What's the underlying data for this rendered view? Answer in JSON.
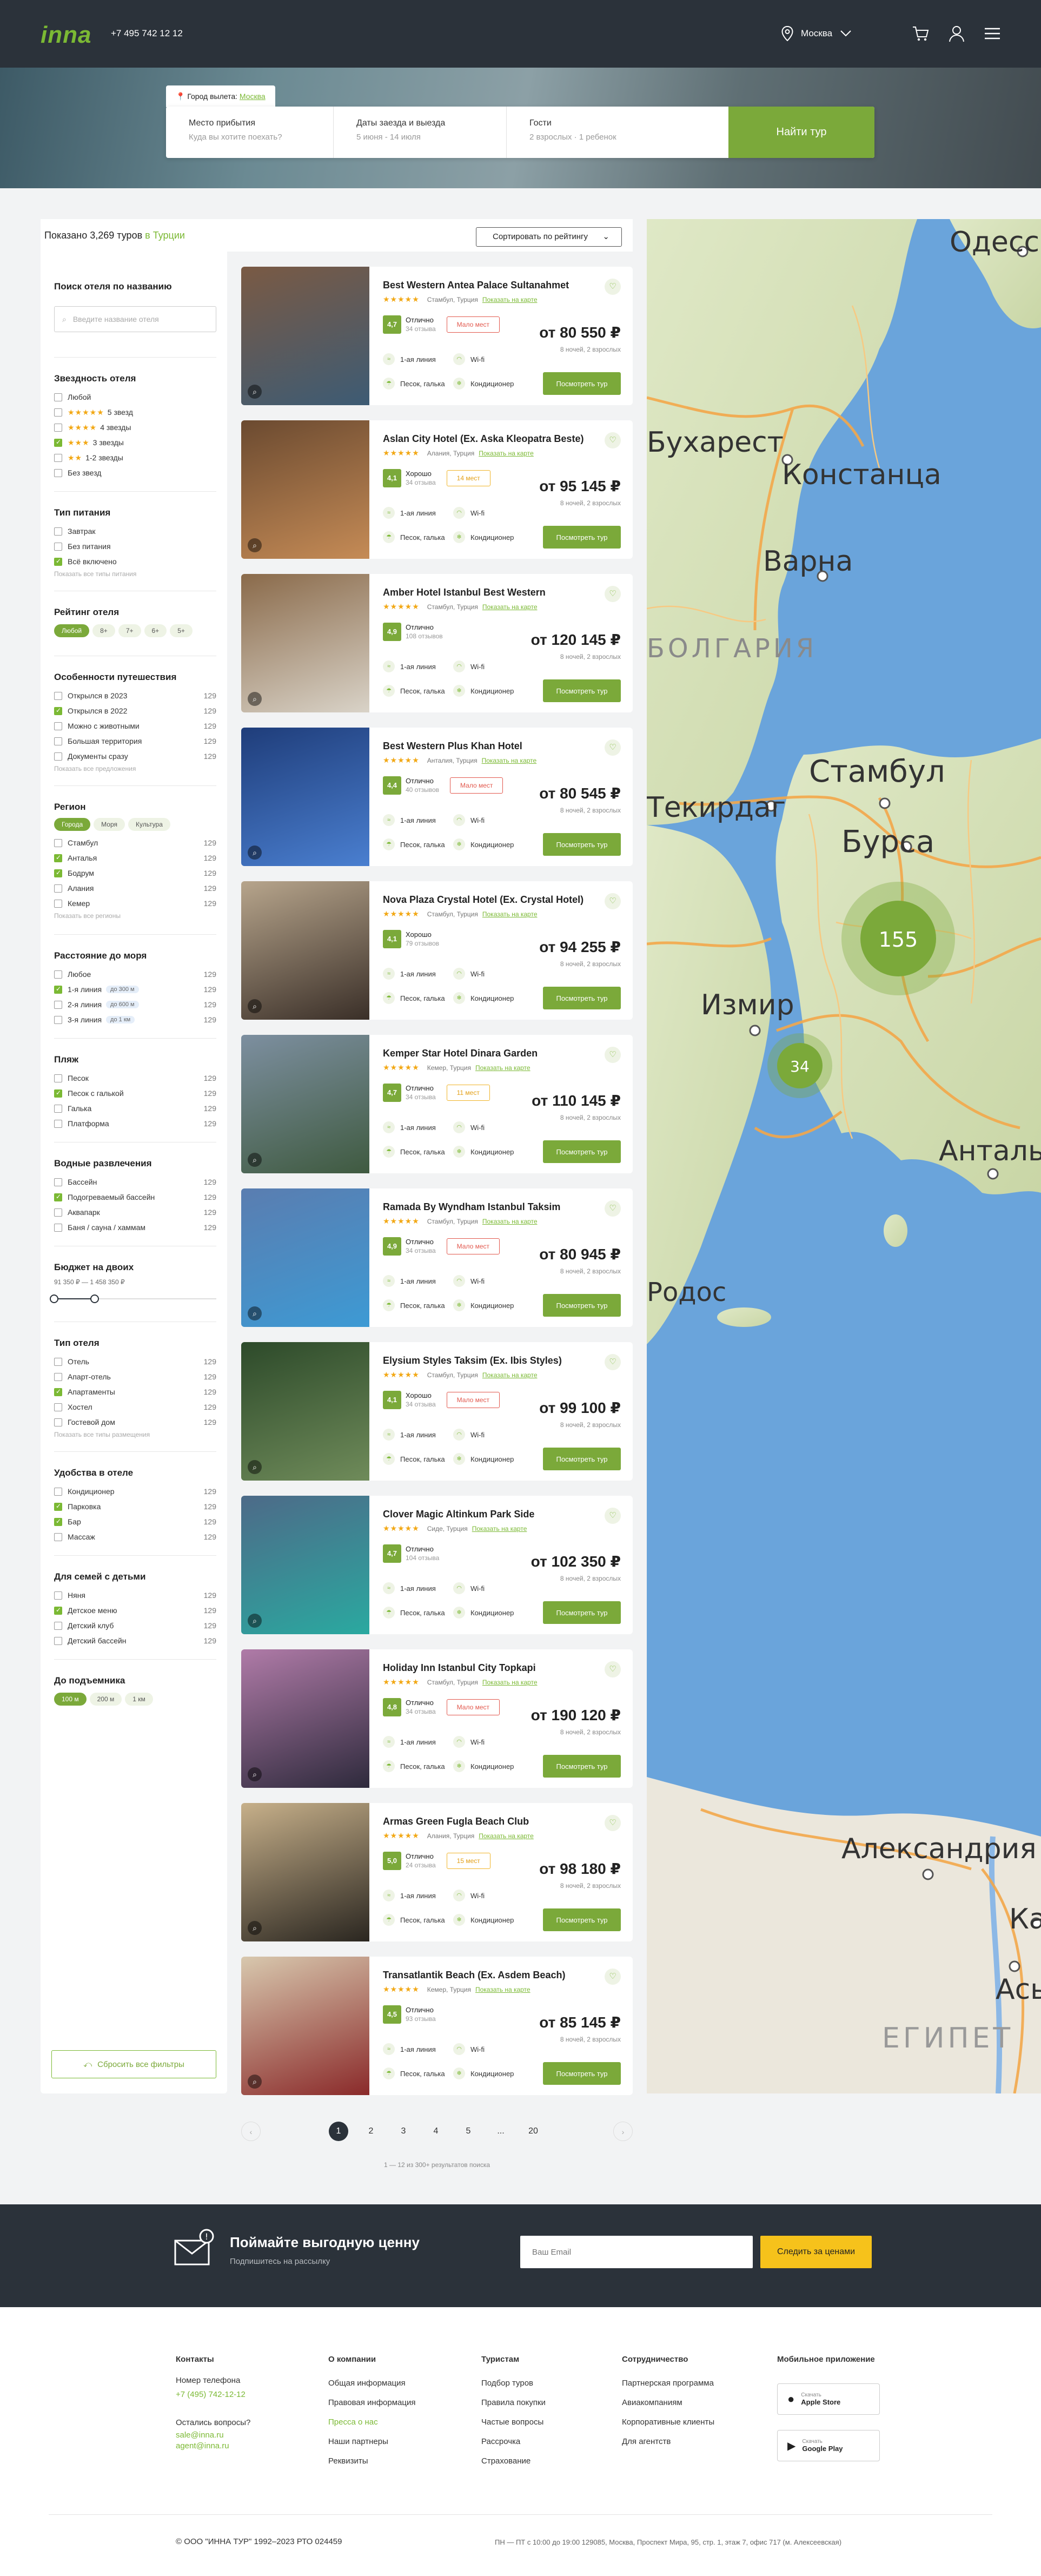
{
  "header": {
    "logo": "inna",
    "phone": "+7 495 742 12 12",
    "city": "Москва"
  },
  "hero": {
    "departure_label": "Город вылета:",
    "departure_city": "Москва",
    "fields": [
      {
        "label": "Место прибытия",
        "value": "Куда вы хотите поехать?"
      },
      {
        "label": "Даты заезда и выезда",
        "value": "5 июня - 14 июля"
      },
      {
        "label": "Гости",
        "value": "2 взрослых · 1 ребенок"
      }
    ],
    "button": "Найти тур"
  },
  "results": {
    "prefix": "Показано",
    "count": "3,269 туров",
    "suffix": "в Турции",
    "sort": "Сортировать по рейтингу"
  },
  "filters": {
    "name_search": {
      "title": "Поиск отеля по названию",
      "placeholder": "Введите название отеля"
    },
    "stars": {
      "title": "Звездность отеля",
      "items": [
        {
          "label": "Любой",
          "stars": "",
          "on": false
        },
        {
          "label": "5 звезд",
          "stars": "★★★★★",
          "on": false
        },
        {
          "label": "4 звезды",
          "stars": "★★★★",
          "on": false
        },
        {
          "label": "3 звезды",
          "stars": "★★★",
          "on": true
        },
        {
          "label": "1-2 звезды",
          "stars": "★★",
          "on": false
        },
        {
          "label": "Без звезд",
          "stars": "",
          "on": false
        }
      ]
    },
    "meal": {
      "title": "Тип питания",
      "items": [
        {
          "label": "Завтрак",
          "on": false
        },
        {
          "label": "Без питания",
          "on": false
        },
        {
          "label": "Всё включено",
          "on": true
        }
      ],
      "more": "Показать все типы питания"
    },
    "rating": {
      "title": "Рейтинг отеля",
      "pills": [
        "Любой",
        "8+",
        "7+",
        "6+",
        "5+"
      ]
    },
    "features": {
      "title": "Особенности путешествия",
      "items": [
        {
          "label": "Открылся в 2023",
          "count": "129",
          "on": false
        },
        {
          "label": "Открылся в 2022",
          "count": "129",
          "on": true
        },
        {
          "label": "Можно с животными",
          "count": "129",
          "on": false
        },
        {
          "label": "Большая территория",
          "count": "129",
          "on": false
        },
        {
          "label": "Документы сразу",
          "count": "129",
          "on": false
        }
      ],
      "more": "Показать все предложения"
    },
    "region": {
      "title": "Регион",
      "tabs": [
        "Города",
        "Моря",
        "Культура"
      ],
      "items": [
        {
          "label": "Стамбул",
          "count": "129",
          "on": false
        },
        {
          "label": "Анталья",
          "count": "129",
          "on": true
        },
        {
          "label": "Бодрум",
          "count": "129",
          "on": true
        },
        {
          "label": "Алания",
          "count": "129",
          "on": false
        },
        {
          "label": "Кемер",
          "count": "129",
          "on": false
        }
      ],
      "more": "Показать все регионы"
    },
    "sea": {
      "title": "Расстояние до моря",
      "items": [
        {
          "label": "Любое",
          "count": "129",
          "on": false,
          "chip": ""
        },
        {
          "label": "1-я линия",
          "count": "129",
          "on": true,
          "chip": "до 300 м"
        },
        {
          "label": "2-я линия",
          "count": "129",
          "on": false,
          "chip": "до 600 м"
        },
        {
          "label": "3-я линия",
          "count": "129",
          "on": false,
          "chip": "до 1 км"
        }
      ]
    },
    "beach": {
      "title": "Пляж",
      "items": [
        {
          "label": "Песок",
          "count": "129",
          "on": false
        },
        {
          "label": "Песок с галькой",
          "count": "129",
          "on": true
        },
        {
          "label": "Галька",
          "count": "129",
          "on": false
        },
        {
          "label": "Платформа",
          "count": "129",
          "on": false
        }
      ]
    },
    "water": {
      "title": "Водные развлечения",
      "items": [
        {
          "label": "Бассейн",
          "count": "129",
          "on": false
        },
        {
          "label": "Подогреваемый бассейн",
          "count": "129",
          "on": true
        },
        {
          "label": "Аквапарк",
          "count": "129",
          "on": false
        },
        {
          "label": "Баня / сауна / хаммам",
          "count": "129",
          "on": false
        }
      ]
    },
    "budget": {
      "title": "Бюджет на двоих",
      "range": "91 350 ₽ — 1 458 350 ₽",
      "low_fraction": 0.0,
      "high_fraction": 0.25
    },
    "hotel_type": {
      "title": "Тип отеля",
      "items": [
        {
          "label": "Отель",
          "count": "129",
          "on": false
        },
        {
          "label": "Апарт-отель",
          "count": "129",
          "on": false
        },
        {
          "label": "Апартаменты",
          "count": "129",
          "on": true
        },
        {
          "label": "Хостел",
          "count": "129",
          "on": false
        },
        {
          "label": "Гостевой дом",
          "count": "129",
          "on": false
        }
      ],
      "more": "Показать все типы размещения"
    },
    "amenities": {
      "title": "Удобства в отеле",
      "items": [
        {
          "label": "Кондиционер",
          "count": "129",
          "on": false
        },
        {
          "label": "Парковка",
          "count": "129",
          "on": true
        },
        {
          "label": "Бар",
          "count": "129",
          "on": true
        },
        {
          "label": "Массаж",
          "count": "129",
          "on": false
        }
      ]
    },
    "family": {
      "title": "Для семей с детьми",
      "items": [
        {
          "label": "Няня",
          "count": "129",
          "on": false
        },
        {
          "label": "Детское меню",
          "count": "129",
          "on": true
        },
        {
          "label": "Детский клуб",
          "count": "129",
          "on": false
        },
        {
          "label": "Детский бассейн",
          "count": "129",
          "on": false
        }
      ]
    },
    "lift": {
      "title": "До подъемника",
      "pills": [
        "100 м",
        "200 м",
        "1 км"
      ]
    },
    "reset": "Сбросить все фильтры"
  },
  "card_common": {
    "map_link": "Показать на карте",
    "price_note": "8 ночей, 2 взрослых",
    "button": "Посмотреть тур",
    "f1": "1-ая линия",
    "f2": "Wi-fi",
    "f3": "Песок, галька",
    "f4": "Кондиционер"
  },
  "hotels": [
    {
      "name": "Best Western Antea Palace Sultanahmet",
      "loc": "Стамбул, Турция",
      "score": "4,7",
      "rlabel": "Отлично",
      "reviews": "34 отзыва",
      "badge": "Мало мест",
      "badge_type": "r",
      "price": "от 80 550 ₽",
      "img": [
        "#7a5a44",
        "#3d5b74"
      ]
    },
    {
      "name": "Aslan City Hotel (Ex. Aska Kleopatra Beste)",
      "loc": "Алания, Турция",
      "score": "4,1",
      "rlabel": "Хорошо",
      "reviews": "34 отзыва",
      "badge": "14 мест",
      "badge_type": "y",
      "price": "от 95 145 ₽",
      "img": [
        "#6b4a30",
        "#c58b56"
      ]
    },
    {
      "name": "Amber Hotel Istanbul Best Western",
      "loc": "Стамбул, Турция",
      "score": "4,9",
      "rlabel": "Отлично",
      "reviews": "108 отзывов",
      "badge": "",
      "badge_type": "",
      "price": "от 120 145 ₽",
      "img": [
        "#8a6a4a",
        "#d9d3c8"
      ]
    },
    {
      "name": "Best Western Plus Khan Hotel",
      "loc": "Анталия, Турция",
      "score": "4,4",
      "rlabel": "Отлично",
      "reviews": "40 отзывов",
      "badge": "Мало мест",
      "badge_type": "r",
      "price": "от 80 545 ₽",
      "img": [
        "#1f3d7a",
        "#4a7fd0"
      ]
    },
    {
      "name": "Nova Plaza Crystal Hotel (Ex. Crystal Hotel)",
      "loc": "Стамбул, Турция",
      "score": "4,1",
      "rlabel": "Хорошо",
      "reviews": "79 отзывов",
      "badge": "",
      "badge_type": "",
      "price": "от 94 255 ₽",
      "img": [
        "#b7a58c",
        "#3a2f28"
      ]
    },
    {
      "name": "Kemper Star Hotel Dinara Garden",
      "loc": "Кемер, Турция",
      "score": "4,7",
      "rlabel": "Отлично",
      "reviews": "34 отзыва",
      "badge": "11 мест",
      "badge_type": "y",
      "price": "от 110 145 ₽",
      "img": [
        "#7d8fa0",
        "#3f5a40"
      ]
    },
    {
      "name": "Ramada By Wyndham Istanbul Taksim",
      "loc": "Стамбул, Турция",
      "score": "4,9",
      "rlabel": "Отлично",
      "reviews": "34 отзыва",
      "badge": "Мало мест",
      "badge_type": "r",
      "price": "от 80 945 ₽",
      "img": [
        "#5a7db0",
        "#3d9ad4"
      ]
    },
    {
      "name": "Elysium Styles Taksim (Ex. Ibis Styles)",
      "loc": "Стамбул, Турция",
      "score": "4,1",
      "rlabel": "Хорошо",
      "reviews": "34 отзыва",
      "badge": "Мало мест",
      "badge_type": "r",
      "price": "от 99 100 ₽",
      "img": [
        "#2d4a2a",
        "#6f8b5a"
      ]
    },
    {
      "name": "Clover Magic Altinkum Park Side",
      "loc": "Сиде, Турция",
      "score": "4,7",
      "rlabel": "Отлично",
      "reviews": "104 отзыва",
      "badge": "",
      "badge_type": "",
      "price": "от 102 350 ₽",
      "img": [
        "#4d6a88",
        "#2aa9a0"
      ]
    },
    {
      "name": "Holiday Inn Istanbul City Topkapi",
      "loc": "Стамбул, Турция",
      "score": "4,8",
      "rlabel": "Отлично",
      "reviews": "34 отзыва",
      "badge": "Мало мест",
      "badge_type": "r",
      "price": "от 190 120 ₽",
      "img": [
        "#b07ba8",
        "#2e2a3c"
      ]
    },
    {
      "name": "Armas Green Fugla Beach Club",
      "loc": "Алания, Турция",
      "score": "5,0",
      "rlabel": "Отлично",
      "reviews": "24 отзыва",
      "badge": "15 мест",
      "badge_type": "y",
      "price": "от 98 180 ₽",
      "img": [
        "#c7b08a",
        "#2a2620"
      ]
    },
    {
      "name": "Transatlantik Beach (Ex. Asdem Beach)",
      "loc": "Кемер, Турция",
      "score": "4,5",
      "rlabel": "Отлично",
      "reviews": "93 отзыва",
      "badge": "",
      "badge_type": "",
      "price": "от 85 145 ₽",
      "img": [
        "#d8c8ae",
        "#8a2a2a"
      ]
    }
  ],
  "map": {
    "labels": [
      "Одесса",
      "Бухарест",
      "Констанца",
      "Варна",
      "БОЛГАРИЯ",
      "Стамбул",
      "Текирдаг",
      "Бурса",
      "Измир",
      "Анталья",
      "Родос",
      "Александрия",
      "Каир",
      "Асьют",
      "ЕГИПЕТ"
    ],
    "clusters": [
      "155",
      "34"
    ]
  },
  "pagination": {
    "pages": [
      "1",
      "2",
      "3",
      "4",
      "5",
      "...",
      "20"
    ],
    "current": "1",
    "note": "1 — 12 из 300+ результатов поиска"
  },
  "newsletter": {
    "title": "Поймайте выгодную ценну",
    "subtitle": "Подпишитесь на рассылку",
    "placeholder": "Ваш Email",
    "button": "Следить за ценами"
  },
  "footer": {
    "contacts": {
      "title": "Контакты",
      "phone_label": "Номер телефона",
      "phone": "+7 (495) 742-12-12",
      "q": "Остались вопросы?",
      "mail1": "sale@inna.ru",
      "mail2": "agent@inna.ru"
    },
    "company": {
      "title": "О компании",
      "items": [
        "Общая информация",
        "Правовая информация",
        "Пресса о нас",
        "Наши партнеры",
        "Реквизиты"
      ]
    },
    "tourists": {
      "title": "Туристам",
      "items": [
        "Подбор туров",
        "Правила покупки",
        "Частые вопросы",
        "Рассрочка",
        "Страхование"
      ]
    },
    "partners": {
      "title": "Сотрудничество",
      "items": [
        "Партнерская программа",
        "Авиакомпаниям",
        "Корпоративные клиенты",
        "Для агентств"
      ]
    },
    "app": {
      "title": "Мобильное приложение",
      "store1_small": "Скачать",
      "store1": "Apple Store",
      "store2_small": "Скачать",
      "store2": "Google Play"
    },
    "copyright": "© ООО \"ИННА ТУР\" 1992–2023 РТО 024459",
    "address": "ПН — ПТ с 10:00 до 19:00 129085, Москва, Проспект Мира, 95, стр. 1, этаж 7, офис 717 (м. Алексеевская)"
  }
}
